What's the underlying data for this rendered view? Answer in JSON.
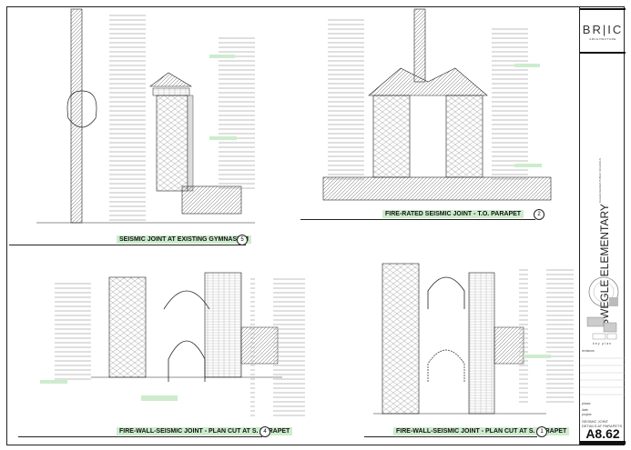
{
  "title_block": {
    "logo": "BR|IC",
    "logo_sub": "ARCHITECTURE",
    "project_name": "SWEGLE ELEMENTARY",
    "client": "SALEM-KEIZER PUBLIC SCHOOLS",
    "key_plan_label": "key plan",
    "revisions_label": "revisions",
    "phase_label": "phase",
    "date_label": "date",
    "project_label": "project",
    "sheet_title": "SEISMIC JOINT DETAILS AT PARAPETS",
    "sheet_number": "A8.62"
  },
  "details": [
    {
      "number": "5",
      "title": "SEISMIC JOINT  AT EXISTING GYMNASIUM"
    },
    {
      "number": "2",
      "title": "FIRE-RATED SEISMIC JOINT - T.O. PARAPET"
    },
    {
      "number": "4",
      "title": "FIRE-WALL-SEISMIC JOINT - PLAN CUT AT S. PARAPET"
    },
    {
      "number": "1",
      "title": "FIRE-WALL-SEISMIC JOINT - PLAN CUT AT S. PARAPET"
    }
  ],
  "colors": {
    "highlight": "#cdeccd",
    "line": "#222222"
  }
}
